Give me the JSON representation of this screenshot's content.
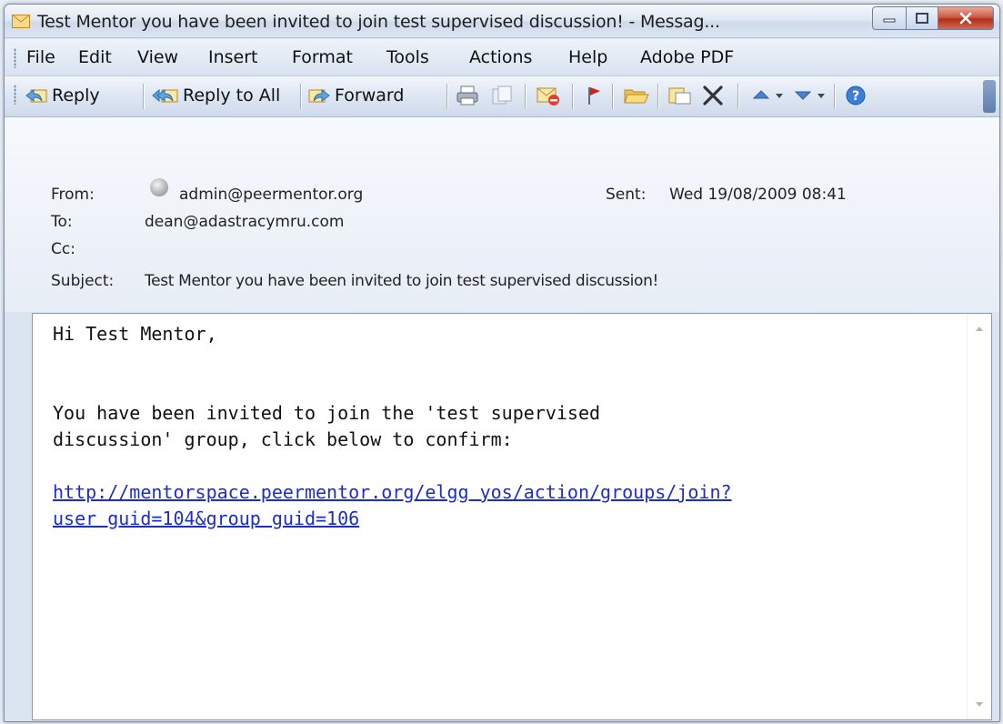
{
  "window": {
    "title": "Test Mentor you have been invited to join test supervised discussion! - Messag..."
  },
  "menu": {
    "items": [
      "File",
      "Edit",
      "View",
      "Insert",
      "Format",
      "Tools",
      "Actions",
      "Help",
      "Adobe PDF"
    ]
  },
  "toolbar": {
    "reply": "Reply",
    "reply_all": "Reply to All",
    "forward": "Forward"
  },
  "header": {
    "from_label": "From:",
    "from_value": "admin@peermentor.org",
    "to_label": "To:",
    "to_value": "dean@adastracymru.com",
    "cc_label": "Cc:",
    "cc_value": "",
    "subject_label": "Subject:",
    "subject_value": "Test Mentor you have been invited to join test supervised discussion!",
    "sent_label": "Sent:",
    "sent_value": "Wed 19/08/2009 08:41"
  },
  "message": {
    "greeting": "Hi Test Mentor,",
    "line1": "You have been invited to join the 'test supervised",
    "line2": "discussion' group, click below to confirm:",
    "link_line1": "http://mentorspace.peermentor.org/elgg yos/action/groups/join?",
    "link_line2": "user guid=104&group guid=106"
  },
  "colors": {
    "link": "#1d2ec8",
    "close_button": "#c4432d",
    "chrome": "#dbe4f1"
  }
}
